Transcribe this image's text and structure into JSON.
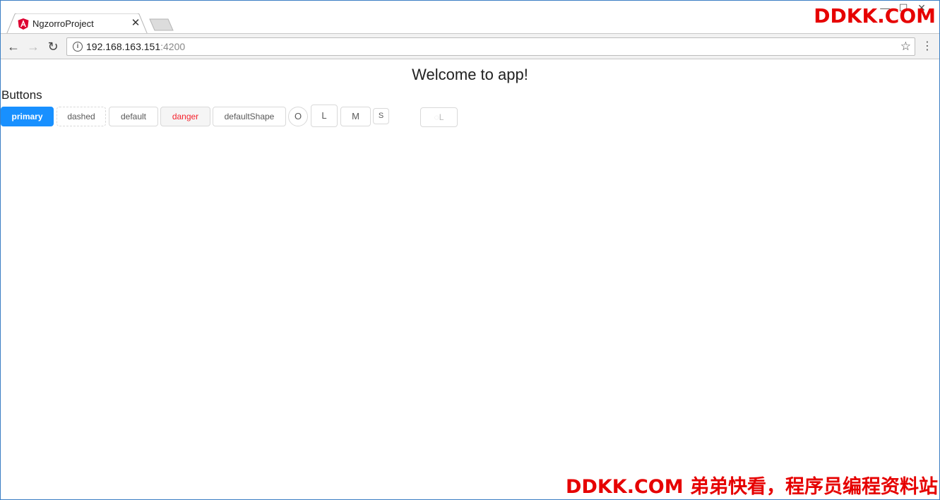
{
  "browser": {
    "tab_title": "NgzorroProject",
    "tab_close": "✕",
    "window_controls": [
      "—",
      "☐",
      "✕"
    ],
    "back": "←",
    "forward": "→",
    "reload": "↻",
    "url_host": "192.168.163.151",
    "url_port": ":4200",
    "info": "i",
    "star": "☆",
    "menu": "⋮"
  },
  "page": {
    "title": "Welcome to app!",
    "section_title": "Buttons",
    "buttons": {
      "primary": "primary",
      "dashed": "dashed",
      "default": "default",
      "danger": "danger",
      "default_shape": "defaultShape",
      "circle": "O",
      "large": "L",
      "medium": "M",
      "small": "S",
      "loading": "L"
    }
  },
  "watermark": {
    "top": "DDKK.COM",
    "bottom": "DDKK.COM 弟弟快看，程序员编程资料站"
  },
  "colors": {
    "primary": "#1890ff",
    "danger_text": "#f5222d",
    "watermark": "#e60000"
  }
}
